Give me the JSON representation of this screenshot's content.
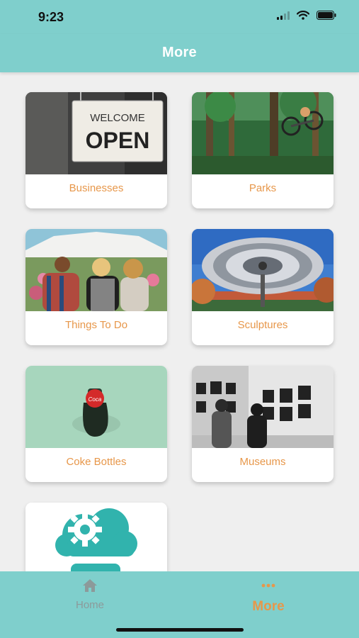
{
  "status": {
    "time": "9:23"
  },
  "header": {
    "title": "More"
  },
  "cards": [
    {
      "label": "Businesses",
      "icon": "open-sign-photo"
    },
    {
      "label": "Parks",
      "icon": "forest-bike-photo"
    },
    {
      "label": "Things To Do",
      "icon": "festival-crowd-photo"
    },
    {
      "label": "Sculptures",
      "icon": "sculpture-photo"
    },
    {
      "label": "Coke Bottles",
      "icon": "coke-bottle-photo"
    },
    {
      "label": "Museums",
      "icon": "gallery-photo"
    },
    {
      "label": "",
      "icon": "cloud-gear-icon"
    }
  ],
  "tabs": [
    {
      "label": "Home",
      "icon": "home-icon"
    },
    {
      "label": "More",
      "icon": "more-dots-icon"
    }
  ],
  "colors": {
    "accent": "#7fcfcc",
    "label": "#e7974a",
    "active_tab": "#e7974a",
    "inactive_tab": "#8c9a9a"
  }
}
